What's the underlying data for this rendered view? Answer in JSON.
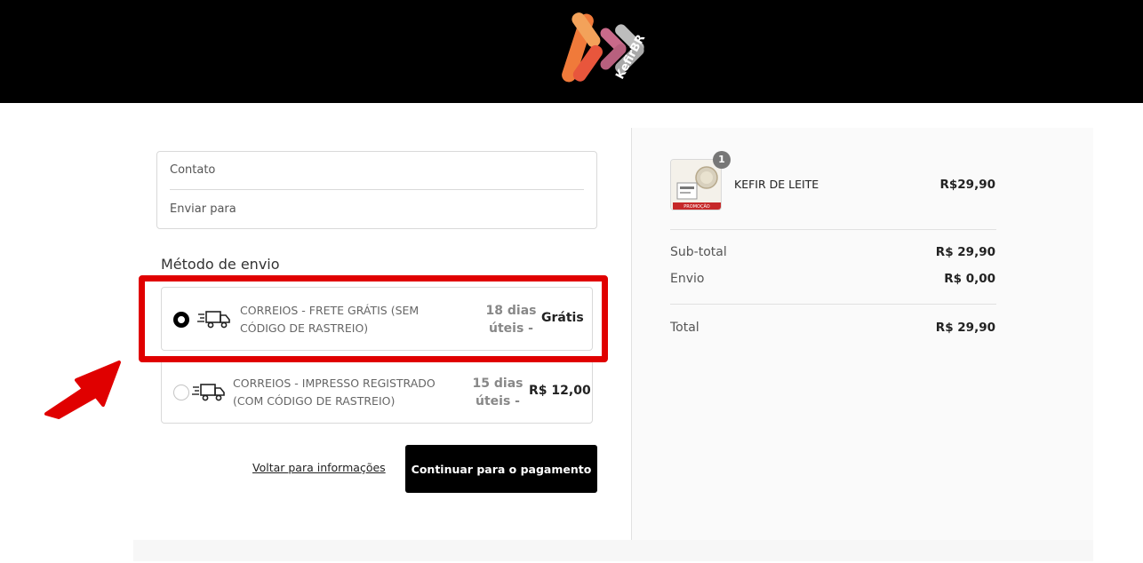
{
  "header": {
    "logo_text": "KefirBR",
    "logo_letter": "K"
  },
  "contact_box": {
    "contact_label": "Contato",
    "ship_to_label": "Enviar para"
  },
  "shipping": {
    "section_title": "Método de envio",
    "options": [
      {
        "name_line1": "CORREIOS - FRETE GRÁTIS (SEM",
        "name_line2": "CÓDIGO DE RASTREIO)",
        "days_line1": "18 dias",
        "days_line2": "úteis -",
        "price": "Grátis",
        "selected": true,
        "icon": "truck-icon"
      },
      {
        "name_line1": "CORREIOS - IMPRESSO REGISTRADO",
        "name_line2": "(COM CÓDIGO DE RASTREIO)",
        "days_line1": "15 dias",
        "days_line2": "úteis -",
        "price": "R$ 12,00",
        "selected": false,
        "icon": "truck-icon"
      }
    ]
  },
  "actions": {
    "back_label": "Voltar para informações",
    "continue_label": "Continuar para o pagamento"
  },
  "order": {
    "product": {
      "quantity": "1",
      "name": "KEFIR DE LEITE",
      "price": "R$29,90",
      "image_tag": "PROMOÇÃO"
    },
    "subtotal_label": "Sub-total",
    "subtotal_value": "R$ 29,90",
    "shipping_label": "Envio",
    "shipping_value": "R$ 0,00",
    "total_label": "Total",
    "total_value": "R$ 29,90"
  },
  "colors": {
    "highlight": "#e00000",
    "arrow": "#e00000",
    "button_bg": "#000000",
    "header_bg": "#000000"
  }
}
